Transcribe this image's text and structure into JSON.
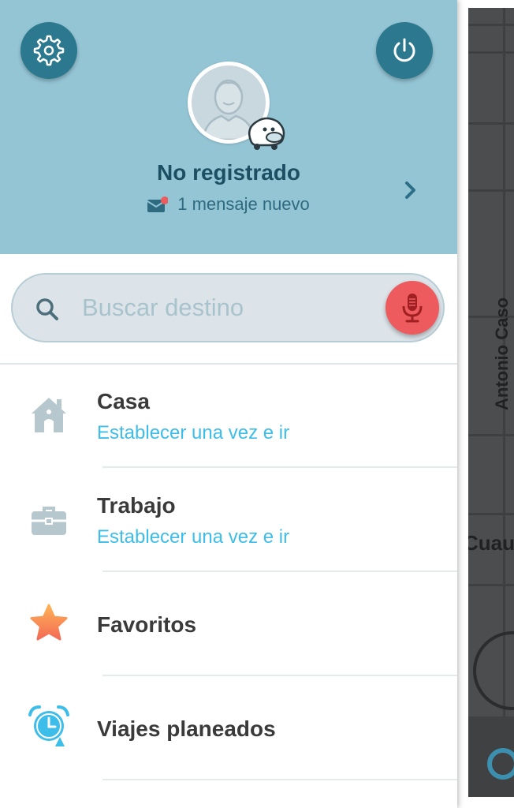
{
  "header": {
    "username": "No registrado",
    "messages_text": "1 mensaje nuevo",
    "settings_icon": "gear-icon",
    "power_icon": "power-icon"
  },
  "search": {
    "placeholder": "Buscar destino"
  },
  "items": [
    {
      "title": "Casa",
      "subtitle": "Establecer una vez e ir",
      "icon": "home-icon"
    },
    {
      "title": "Trabajo",
      "subtitle": "Establecer una vez e ir",
      "icon": "briefcase-icon"
    },
    {
      "title": "Favoritos",
      "subtitle": "",
      "icon": "star-icon"
    },
    {
      "title": "Viajes planeados",
      "subtitle": "",
      "icon": "alarm-clock-icon"
    }
  ],
  "map": {
    "street_vertical": "Antonio Caso",
    "street_horizontal": "Cuau"
  },
  "colors": {
    "header_bg": "#94c5d5",
    "header_button": "#2c788f",
    "mic_button": "#ee5b5e",
    "accent_text": "#3dbde9"
  }
}
